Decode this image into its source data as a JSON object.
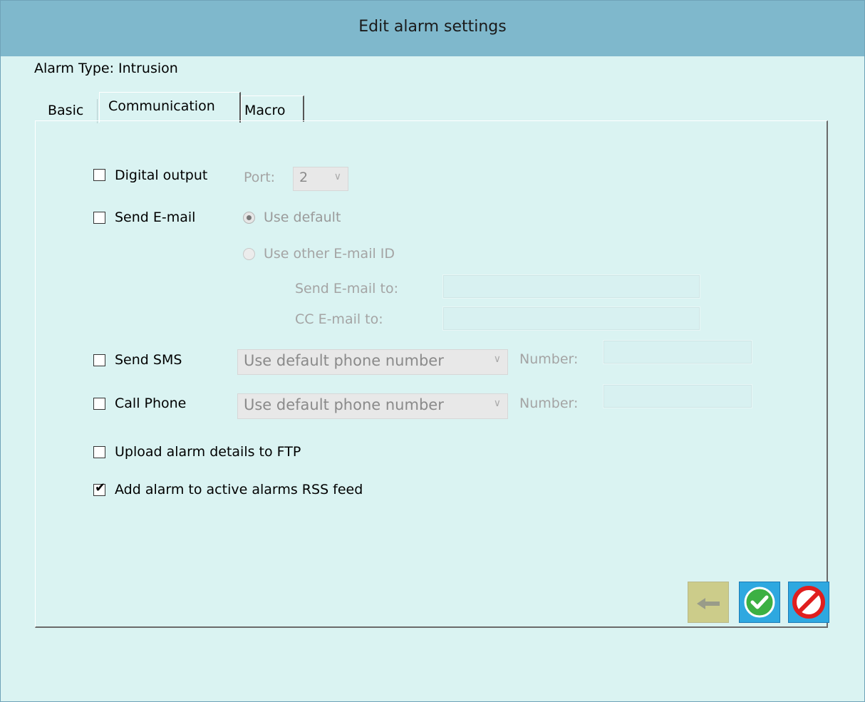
{
  "window": {
    "title": "Edit alarm settings"
  },
  "alarm_type": "Alarm Type: Intrusion",
  "tabs": [
    {
      "label": "Basic",
      "active": false
    },
    {
      "label": "Communication",
      "active": true
    },
    {
      "label": "Macro",
      "active": false
    }
  ],
  "communication": {
    "digital_output": {
      "label": "Digital output",
      "checked": false,
      "port_label": "Port:",
      "port_value": "2"
    },
    "send_email": {
      "label": "Send E-mail",
      "checked": false,
      "use_default_label": "Use default",
      "use_other_label": "Use other E-mail ID",
      "send_to_label": "Send E-mail to:",
      "send_to_value": "",
      "cc_label": "CC E-mail to:",
      "cc_value": ""
    },
    "send_sms": {
      "label": "Send SMS",
      "checked": false,
      "select_value": "Use default phone number",
      "number_label": "Number:",
      "number_value": ""
    },
    "call_phone": {
      "label": "Call Phone",
      "checked": false,
      "select_value": "Use default phone number",
      "number_label": "Number:",
      "number_value": ""
    },
    "upload_ftp": {
      "label": "Upload alarm details to FTP",
      "checked": false
    },
    "add_rss": {
      "label": "Add alarm to active alarms RSS feed",
      "checked": true
    }
  },
  "buttons": {
    "back_icon": "arrow-left-icon",
    "ok_icon": "checkmark-icon",
    "cancel_icon": "no-entry-icon"
  },
  "colors": {
    "titlebar": "#7fb8cc",
    "background": "#daf3f2",
    "button_blue": "#2ea8e0",
    "ok_green": "#3cb043",
    "cancel_red": "#e01e1e"
  }
}
